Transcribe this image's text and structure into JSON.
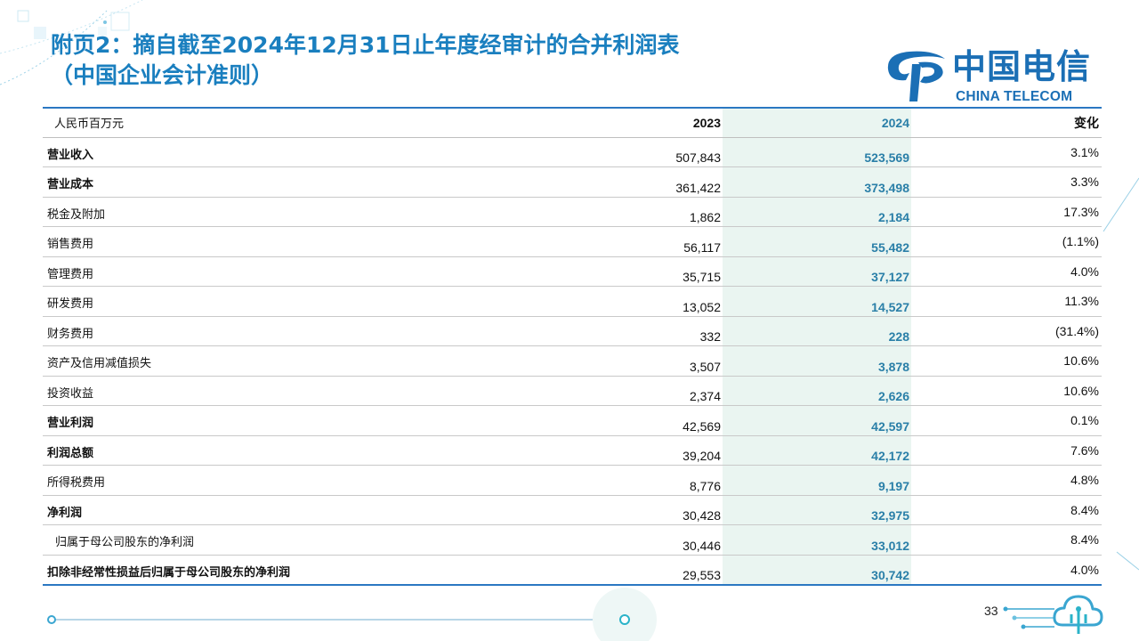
{
  "header": {
    "title_line1": "附页2：摘自截至2024年12月31日止年度经审计的合并利润表",
    "title_line2": "（中国企业会计准则）"
  },
  "logo": {
    "cn": "中国电信",
    "en": "CHINA TELECOM",
    "icon": "china-telecom-logo-icon"
  },
  "table": {
    "columns": [
      "人民币百万元",
      "2023",
      "2024",
      "变化"
    ],
    "rows": [
      {
        "label": "营业收入",
        "y2023": "507,843",
        "y2024": "523,569",
        "change": "3.1%"
      },
      {
        "label": "营业成本",
        "y2023": "361,422",
        "y2024": "373,498",
        "change": "3.3%"
      },
      {
        "label": "税金及附加",
        "y2023": "1,862",
        "y2024": "2,184",
        "change": "17.3%"
      },
      {
        "label": "销售费用",
        "y2023": "56,117",
        "y2024": "55,482",
        "change": "(1.1%)"
      },
      {
        "label": "管理费用",
        "y2023": "35,715",
        "y2024": "37,127",
        "change": "4.0%"
      },
      {
        "label": "研发费用",
        "y2023": "13,052",
        "y2024": "14,527",
        "change": "11.3%"
      },
      {
        "label": "财务费用",
        "y2023": "332",
        "y2024": "228",
        "change": "(31.4%)"
      },
      {
        "label": "资产及信用减值损失",
        "y2023": "3,507",
        "y2024": "3,878",
        "change": "10.6%"
      },
      {
        "label": "投资收益",
        "y2023": "2,374",
        "y2024": "2,626",
        "change": "10.6%"
      },
      {
        "label": "营业利润",
        "y2023": "42,569",
        "y2024": "42,597",
        "change": "0.1%"
      },
      {
        "label": "利润总额",
        "y2023": "39,204",
        "y2024": "42,172",
        "change": "7.6%"
      },
      {
        "label": "所得税费用",
        "y2023": "8,776",
        "y2024": "9,197",
        "change": "4.8%"
      },
      {
        "label": "净利润",
        "y2023": "30,428",
        "y2024": "32,975",
        "change": "8.4%"
      },
      {
        "label": "归属于母公司股东的净利润",
        "y2023": "30,446",
        "y2024": "33,012",
        "change": "8.4%"
      },
      {
        "label": "扣除非经常性损益后归属于母公司股东的净利润",
        "y2023": "29,553",
        "y2024": "30,742",
        "change": "4.0%"
      }
    ]
  },
  "footer": {
    "page_number": "33",
    "icon": "cloud-icon"
  },
  "colors": {
    "title": "#1a7fbf",
    "accent_line": "#2b78c2",
    "highlight_column": "#eaf5f1",
    "value_2024": "#2a7fa8"
  }
}
